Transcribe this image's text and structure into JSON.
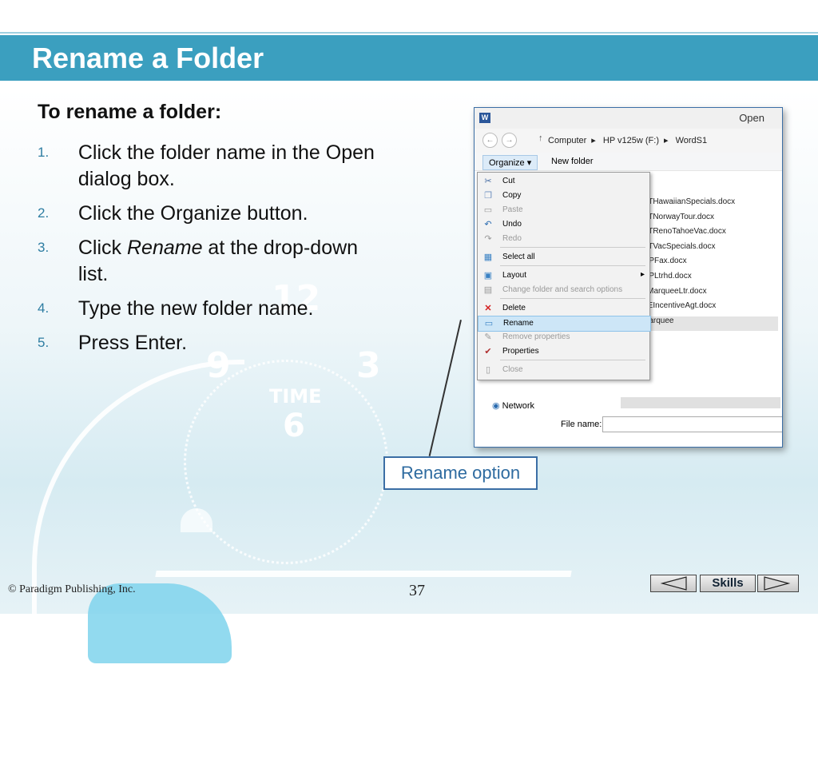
{
  "slide": {
    "title": "Rename a Folder",
    "subhead": "To rename a folder:",
    "steps": [
      {
        "num": "1.",
        "parts": [
          "Click the folder name in the Open dialog box."
        ]
      },
      {
        "num": "2.",
        "parts": [
          "Click the Organize button."
        ]
      },
      {
        "num": "3.",
        "before": "Click ",
        "italic": "Rename",
        "after": " at the drop-down list."
      },
      {
        "num": "4.",
        "parts": [
          "Type the new folder name."
        ]
      },
      {
        "num": "5.",
        "parts": [
          "Press Enter."
        ]
      }
    ],
    "background_numbers": {
      "twelve": "12",
      "nine": "9",
      "three": "3",
      "six": "6",
      "time": "TIME"
    }
  },
  "dialog": {
    "title": "Open",
    "app_icon": "W",
    "address": {
      "crumbs": [
        "Computer",
        "HP v125w (F:)",
        "WordS1"
      ]
    },
    "toolbar": {
      "organize": "Organize ▾",
      "new_folder": "New folder"
    },
    "files": [
      "CTHawaiianSpecials.docx",
      "CTNorwayTour.docx",
      "CTRenoTahoeVac.docx",
      "CTVacSpecials.docx",
      "MPFax.docx",
      "MPLtrhd.docx",
      "TMarqueeLtr.docx",
      "VEIncentiveAgt.docx",
      "Marquee"
    ],
    "menu": [
      {
        "label": "Cut",
        "icon": "scissors-icon",
        "disabled": false
      },
      {
        "label": "Copy",
        "icon": "copy-icon",
        "disabled": false
      },
      {
        "label": "Paste",
        "icon": "paste-icon",
        "disabled": true
      },
      {
        "label": "Undo",
        "icon": "undo-icon",
        "disabled": false
      },
      {
        "label": "Redo",
        "icon": "redo-icon",
        "disabled": true
      },
      {
        "label": "Select all",
        "icon": "select-all-icon",
        "disabled": false
      },
      {
        "label": "Layout",
        "icon": "layout-icon",
        "disabled": false,
        "submenu": true
      },
      {
        "label": "Change folder and search options",
        "icon": "options-icon",
        "disabled": true
      },
      {
        "label": "Delete",
        "icon": "delete-icon",
        "disabled": false
      },
      {
        "label": "Rename",
        "icon": "rename-icon",
        "disabled": false,
        "selected": true
      },
      {
        "label": "Remove properties",
        "icon": "remove-properties-icon",
        "disabled": true
      },
      {
        "label": "Properties",
        "icon": "properties-icon",
        "disabled": false
      },
      {
        "label": "Close",
        "icon": "close-icon",
        "disabled": true
      }
    ],
    "network": "Network",
    "file_name_label": "File name:"
  },
  "callout": "Rename option",
  "footer": {
    "copyright": "© Paradigm Publishing, Inc.",
    "page": "37",
    "skills": "Skills"
  },
  "colors": {
    "header": "#3b9fbf",
    "accent": "#2e7da2",
    "callout_border": "#3b6ea5"
  }
}
